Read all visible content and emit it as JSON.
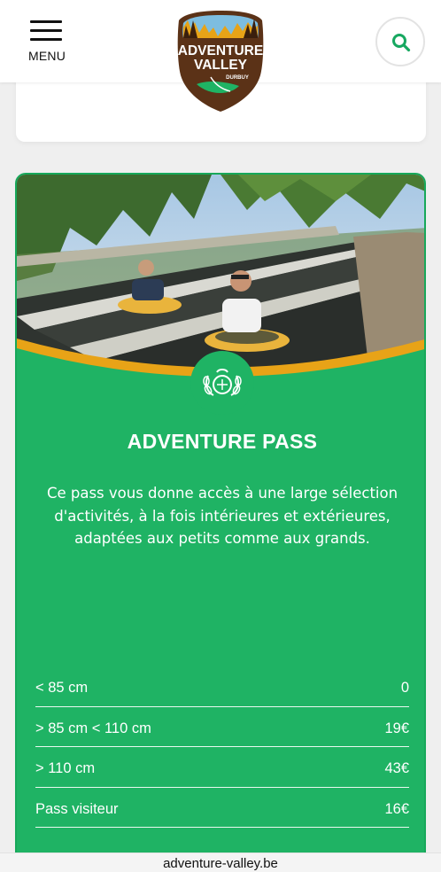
{
  "header": {
    "menu_label": "MENU",
    "logo": {
      "line1": "ADVENTURE",
      "line2": "VALLEY",
      "line3": "DURBUY"
    },
    "search_icon": "search-icon"
  },
  "pass": {
    "title": "ADVENTURE PASS",
    "description": "Ce pass vous donne accès à une large sélection d'activités, à la fois intérieures et extérieures, adaptées aux petits comme aux grands.",
    "badge_icon": "laurel-emblem-icon",
    "prices": [
      {
        "label": "< 85 cm",
        "value": "0"
      },
      {
        "label": "> 85 cm < 110 cm",
        "value": "19€"
      },
      {
        "label": "> 110 cm",
        "value": "43€"
      },
      {
        "label": "Pass visiteur",
        "value": "16€"
      }
    ]
  },
  "browser": {
    "url": "adventure-valley.be"
  },
  "colors": {
    "card_green": "#1fb364",
    "accent_orange": "#e8a317",
    "logo_brown": "#5b3217",
    "search_green": "#17a860"
  }
}
